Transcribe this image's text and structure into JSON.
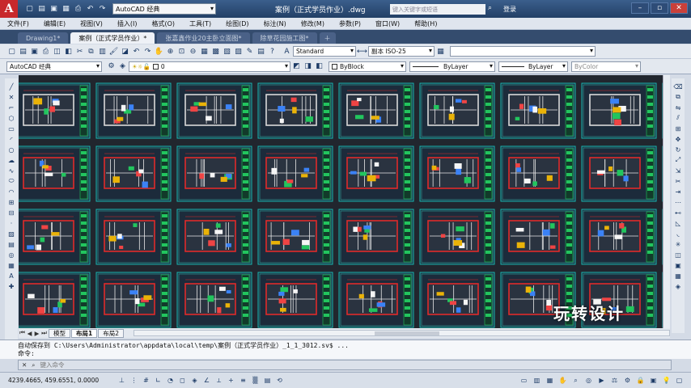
{
  "title_bar": {
    "app_logo": "A",
    "workspace": "AutoCAD 经典",
    "doc_title": "案例（正式学员作业）.dwg",
    "search_placeholder": "键入关键字或短语",
    "user": "登录",
    "quick_access_icons": [
      "new-icon",
      "open-icon",
      "save-icon",
      "saveas-icon",
      "print-icon",
      "undo-icon",
      "redo-icon"
    ]
  },
  "menu": [
    "文件(F)",
    "编辑(E)",
    "视图(V)",
    "插入(I)",
    "格式(O)",
    "工具(T)",
    "绘图(D)",
    "标注(N)",
    "修改(M)",
    "参数(P)",
    "窗口(W)",
    "帮助(H)"
  ],
  "doc_tabs": [
    {
      "label": "Drawing1*",
      "active": false
    },
    {
      "label": "案例（正式学员作业）*",
      "active": true
    },
    {
      "label": "张嘉鑫作业20主卧立面图*",
      "active": false
    },
    {
      "label": "除草花园施工图*",
      "active": false
    }
  ],
  "toolbar1": {
    "text_style": "Standard",
    "dim_style": "副本 ISO-25"
  },
  "toolbar2": {
    "workspace": "AutoCAD 经典",
    "layer": "0",
    "color": "ByBlock",
    "linetype": "ByLayer",
    "lineweight": "ByLayer",
    "plotstyle": "ByColor"
  },
  "layout_tabs": [
    "模型",
    "布局1",
    "布局2"
  ],
  "active_layout": "布局1",
  "command": {
    "history_line1": "自动保存到 C:\\Users\\Administrator\\appdata\\local\\temp\\案例（正式学员作业）_1_1_3012.sv$ ...",
    "history_line2": "命令:",
    "input_placeholder": "键入命令"
  },
  "status": {
    "coords": "4239.4665, 459.6551, 0.0000"
  },
  "watermark": "玩转设计",
  "colors": {
    "canvas_bg": "#21262e",
    "sheet_border": "#19b7b0",
    "sheet_bg": "#1c2b3b"
  }
}
